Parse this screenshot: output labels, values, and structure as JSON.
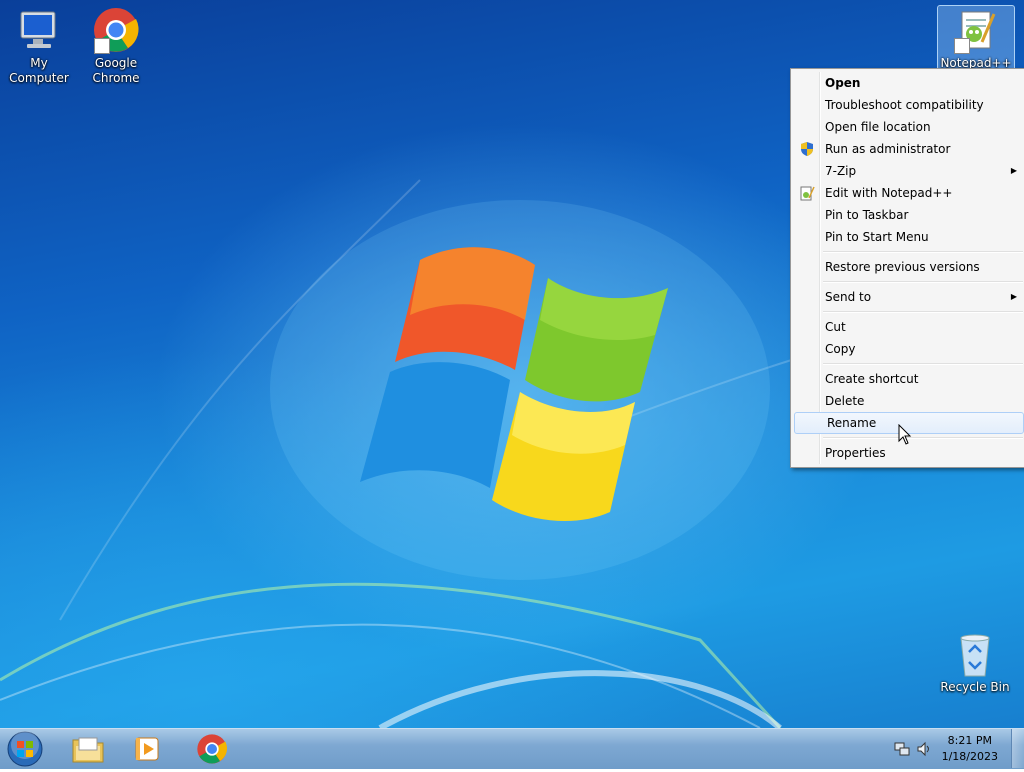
{
  "desktop": {
    "icons": [
      {
        "label": "My Computer",
        "icon": "computer-icon"
      },
      {
        "label": "Google Chrome",
        "icon": "chrome-icon"
      },
      {
        "label": "Notepad++",
        "icon": "notepad-plus-plus-icon"
      },
      {
        "label": "Recycle Bin",
        "icon": "recycle-bin-icon"
      }
    ]
  },
  "context_menu": {
    "items": [
      {
        "label": "Open"
      },
      {
        "label": "Troubleshoot compatibility"
      },
      {
        "label": "Open file location"
      },
      {
        "label": "Run as administrator",
        "icon": "uac-shield-icon"
      },
      {
        "label": "7-Zip",
        "submenu": true
      },
      {
        "label": "Edit with Notepad++",
        "icon": "notepad-plus-plus-icon"
      },
      {
        "label": "Pin to Taskbar"
      },
      {
        "label": "Pin to Start Menu"
      },
      {
        "label": "Restore previous versions"
      },
      {
        "label": "Send to",
        "submenu": true
      },
      {
        "label": "Cut"
      },
      {
        "label": "Copy"
      },
      {
        "label": "Create shortcut"
      },
      {
        "label": "Delete"
      },
      {
        "label": "Rename",
        "highlighted": true
      },
      {
        "label": "Properties"
      }
    ],
    "submenu_arrow": "▶"
  },
  "taskbar": {
    "pinned": [
      {
        "name": "file-explorer",
        "icon": "folder-icon"
      },
      {
        "name": "media-player",
        "icon": "media-player-icon"
      },
      {
        "name": "google-chrome",
        "icon": "chrome-icon"
      }
    ],
    "clock": {
      "time": "8:21 PM",
      "date": "1/18/2023"
    }
  },
  "colors": {
    "menu_bg": "#f5f5f5",
    "menu_highlight_border": "#aecff7",
    "taskbar": "#7ea8d2"
  }
}
